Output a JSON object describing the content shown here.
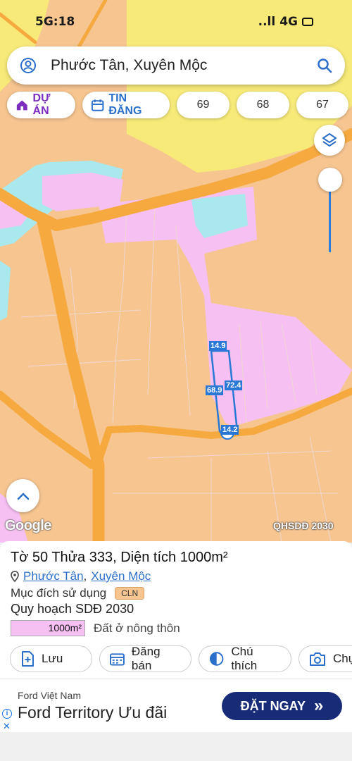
{
  "status_bar": {
    "time": "5G:18",
    "signal": "..ll",
    "network": "4G"
  },
  "search": {
    "query": "Phước Tân, Xuyên Mộc"
  },
  "chips": [
    {
      "label": "DỰ ÁN"
    },
    {
      "label": "TIN ĐĂNG"
    },
    {
      "label": "69"
    },
    {
      "label": "68"
    },
    {
      "label": "67"
    }
  ],
  "map": {
    "attribution": "Google",
    "layer_label": "QHSDĐ 2030",
    "plot_dimensions": [
      "14.9",
      "72.4",
      "68.9",
      "14.2"
    ],
    "colors": {
      "road": "#f5a93f",
      "agricultural": "#f6c590",
      "residential": "#f6c0f2",
      "water": "#a9e9ee",
      "yellow_zone": "#f7ea79",
      "accent": "#2a78d6"
    }
  },
  "panel": {
    "title": "Tờ 50 Thửa 333, Diện tích 1000m²",
    "commune": "Phước Tân",
    "district": "Xuyên Mộc",
    "separator": ",",
    "purpose_label": "Mục đích sử dụng",
    "purpose_code": "CLN",
    "plan_title": "Quy hoạch SDĐ 2030",
    "plan_area": "1000m²",
    "plan_land_type": "Đất ở nông thôn",
    "actions": [
      {
        "label": "Lưu",
        "icon": "add-file-icon"
      },
      {
        "label": "Đăng bán",
        "icon": "calendar-icon"
      },
      {
        "label": "Chú thích",
        "icon": "half-circle-icon"
      },
      {
        "label": "Chụ",
        "icon": "camera-icon"
      }
    ]
  },
  "ad": {
    "brand": "Ford Việt Nam",
    "title": "Ford Territory Ưu đãi",
    "cta": "ĐẶT NGAY",
    "cta_arrow": "»",
    "info": "i",
    "close": "✕"
  }
}
